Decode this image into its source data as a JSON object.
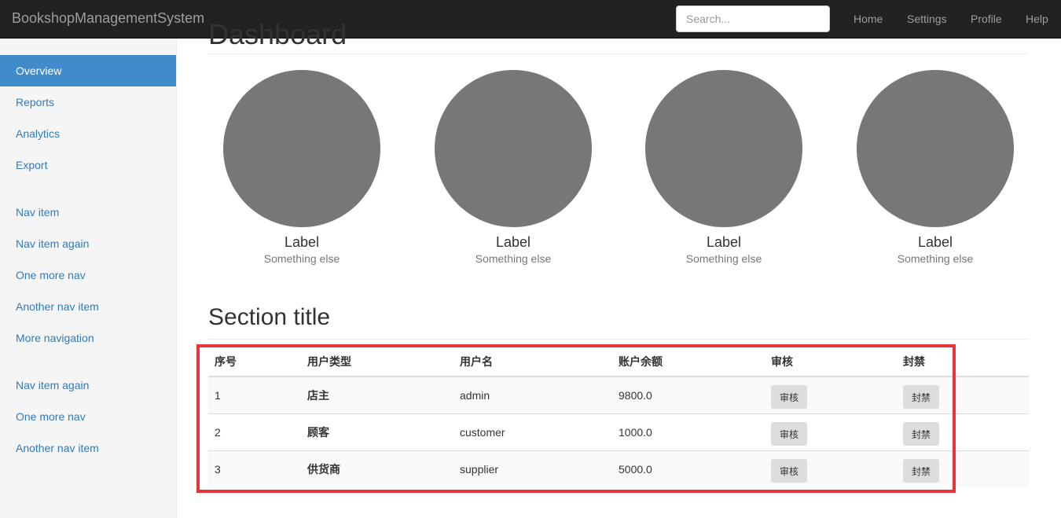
{
  "app": {
    "brand": "BookshopManagementSystem",
    "search_placeholder": "Search...",
    "top_nav": [
      "Home",
      "Settings",
      "Profile",
      "Help"
    ]
  },
  "sidebar": {
    "groups": [
      [
        "Overview",
        "Reports",
        "Analytics",
        "Export"
      ],
      [
        "Nav item",
        "Nav item again",
        "One more nav",
        "Another nav item",
        "More navigation"
      ],
      [
        "Nav item again",
        "One more nav",
        "Another nav item"
      ]
    ],
    "active": "Overview"
  },
  "main": {
    "page_title": "Dashboard",
    "placeholders": [
      {
        "label": "Label",
        "sub": "Something else"
      },
      {
        "label": "Label",
        "sub": "Something else"
      },
      {
        "label": "Label",
        "sub": "Something else"
      },
      {
        "label": "Label",
        "sub": "Something else"
      }
    ],
    "section_title": "Section title",
    "table": {
      "headers": [
        "序号",
        "用户类型",
        "用户名",
        "账户余额",
        "审核",
        "封禁"
      ],
      "rows": [
        {
          "id": "1",
          "type": "店主",
          "username": "admin",
          "balance": "9800.0",
          "audit": "审核",
          "ban": "封禁"
        },
        {
          "id": "2",
          "type": "顾客",
          "username": "customer",
          "balance": "1000.0",
          "audit": "审核",
          "ban": "封禁"
        },
        {
          "id": "3",
          "type": "供货商",
          "username": "supplier",
          "balance": "5000.0",
          "audit": "审核",
          "ban": "封禁"
        }
      ]
    }
  },
  "colors": {
    "navbar": "#222222",
    "sidebar_active": "#428bca",
    "link": "#337ab7",
    "placeholder_circle": "#777777",
    "highlight_box": "#e8353a"
  }
}
